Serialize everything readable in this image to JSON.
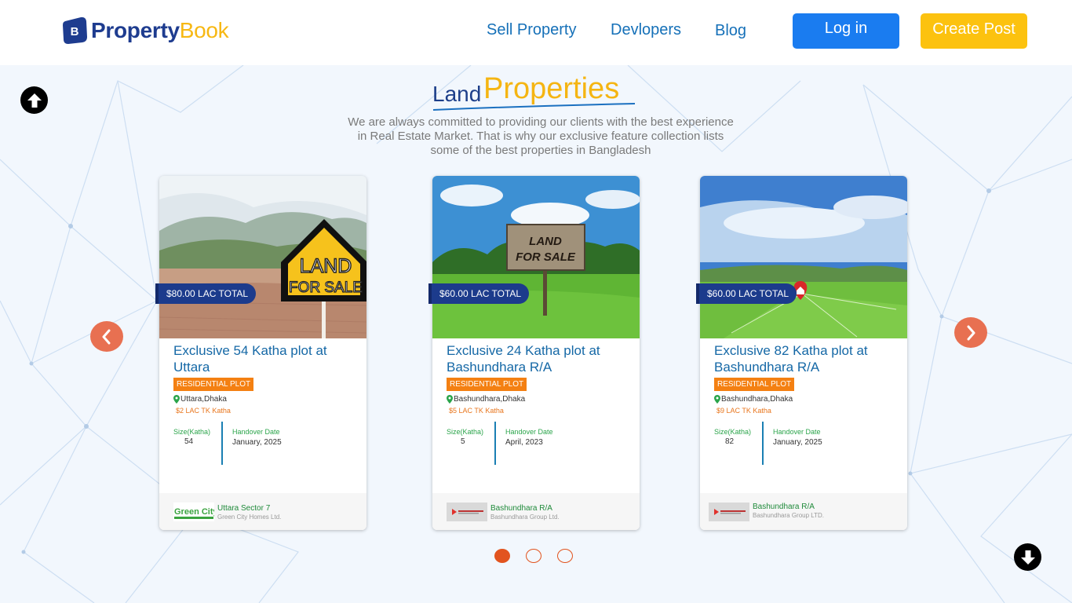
{
  "brand": {
    "name_part1": "Property",
    "name_part2": "Book",
    "mark_letter": "B"
  },
  "nav": [
    {
      "label": "Sell Property"
    },
    {
      "label": "Devlopers"
    },
    {
      "label": "Blog"
    }
  ],
  "header": {
    "login_label": "Log in",
    "create_post_label": "Create Post"
  },
  "section": {
    "title_part1": "Land",
    "title_part2": "Properties",
    "subtitle": "We are always committed to providing our clients with the best experience in Real Estate Market. That is why our exclusive feature collection lists some of the best properties in Bangladesh"
  },
  "cards": [
    {
      "price": "$80.00 LAC TOTAL",
      "title": "Exclusive 54 Katha plot at Uttara",
      "badge": "RESIDENTIAL PLOT",
      "location": "Uttara,Dhaka",
      "rate": "$2 LAC TK Katha",
      "size_label": "Size(Katha)",
      "size_value": "54",
      "handover_label": "Handover Date",
      "handover_value": "January, 2025",
      "developer_location": "Uttara Sector 7",
      "developer_company": "Green City Homes Ltd.",
      "image_sign_line1": "LAND",
      "image_sign_line2": "FOR SALE",
      "dev_logo_text": "Green City"
    },
    {
      "price": "$60.00 LAC TOTAL",
      "title": "Exclusive 24 Katha plot at Bashundhara R/A",
      "badge": "RESIDENTIAL PLOT",
      "location": "Bashundhara,Dhaka",
      "rate": "$5 LAC TK Katha",
      "size_label": "Size(Katha)",
      "size_value": "5",
      "handover_label": "Handover Date",
      "handover_value": "April, 2023",
      "developer_location": "Bashundhara R/A",
      "developer_company": "Bashundhara Group Ltd.",
      "image_sign_line1": "LAND",
      "image_sign_line2": "FOR SALE"
    },
    {
      "price": "$60.00 LAC TOTAL",
      "title": "Exclusive 82 Katha plot at Bashundhara R/A",
      "badge": "RESIDENTIAL PLOT",
      "location": "Bashundhara,Dhaka",
      "rate": "$9 LAC TK Katha",
      "size_label": "Size(Katha)",
      "size_value": "82",
      "handover_label": "Handover Date",
      "handover_value": "January, 2025",
      "developer_location": "Bashundhara R/A",
      "developer_company": "Bashundhara Group LTD."
    }
  ],
  "carousel": {
    "dot_count": 3,
    "active_index": 0
  },
  "colors": {
    "brand_blue": "#1e3c8f",
    "brand_yellow": "#f7b813",
    "login_blue": "#1a7cf0",
    "post_yellow": "#fcc20f",
    "arrow_orange": "#e87051",
    "badge_orange": "#f48012",
    "price_navy": "#1c3b8c"
  },
  "icons": {
    "scroll_up": "arrow-up-circle-icon",
    "scroll_down": "arrow-down-circle-icon",
    "prev": "chevron-left-icon",
    "next": "chevron-right-icon",
    "location": "map-pin-icon"
  }
}
